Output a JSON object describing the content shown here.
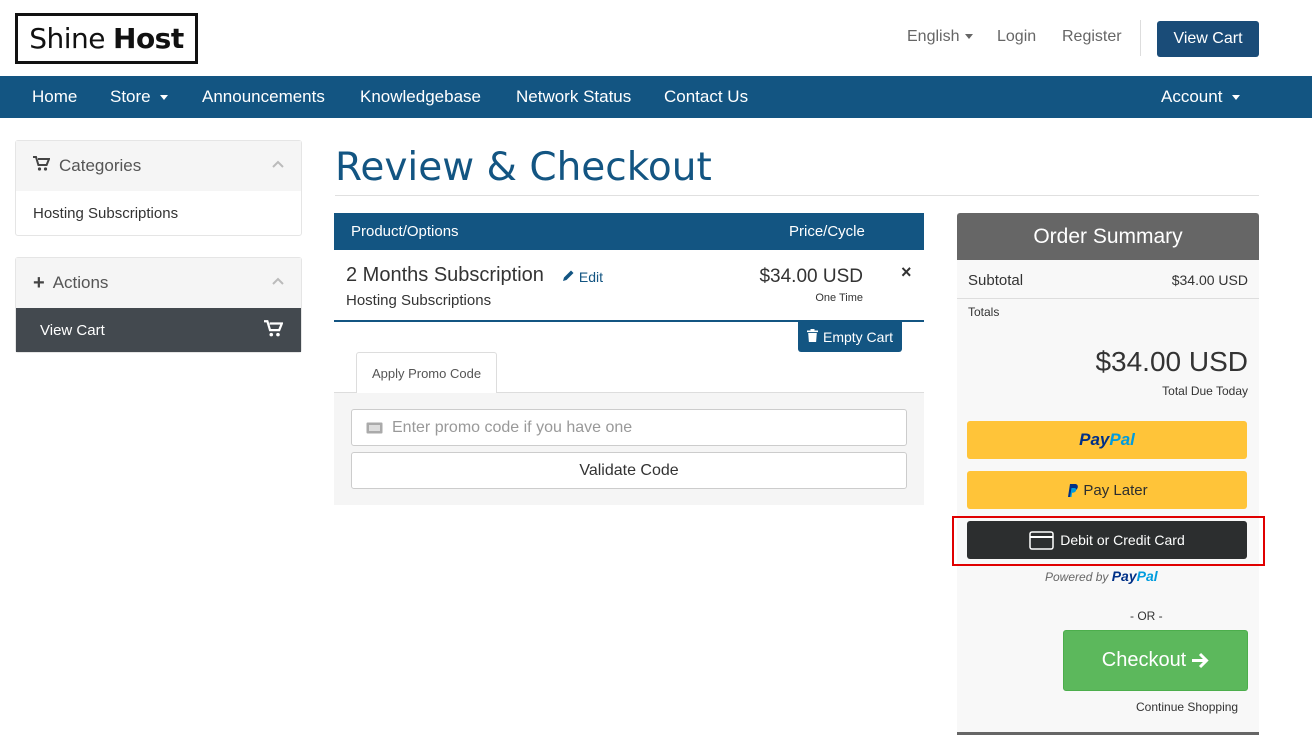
{
  "brand": {
    "logo_left": "Shine",
    "logo_right": "Host"
  },
  "header": {
    "language": "English",
    "login": "Login",
    "register": "Register",
    "view_cart": "View Cart"
  },
  "nav": {
    "items": [
      "Home",
      "Store",
      "Announcements",
      "Knowledgebase",
      "Network Status",
      "Contact Us"
    ],
    "account": "Account"
  },
  "sidebar": {
    "categories": {
      "title": "Categories",
      "items": [
        "Hosting Subscriptions"
      ]
    },
    "actions": {
      "title": "Actions",
      "items": [
        "View Cart"
      ]
    }
  },
  "page": {
    "title": "Review & Checkout"
  },
  "cart": {
    "headers": {
      "product": "Product/Options",
      "price": "Price/Cycle"
    },
    "items": [
      {
        "name": "2 Months Subscription",
        "edit": "Edit",
        "group": "Hosting Subscriptions",
        "price": "$34.00 USD",
        "cycle": "One Time",
        "remove": "×"
      }
    ],
    "empty_cart": "Empty Cart"
  },
  "promo": {
    "tab": "Apply Promo Code",
    "placeholder": "Enter promo code if you have one",
    "validate": "Validate Code"
  },
  "summary": {
    "title": "Order Summary",
    "subtotal_label": "Subtotal",
    "subtotal_value": "$34.00 USD",
    "totals_label": "Totals",
    "total_value": "$34.00 USD",
    "total_caption": "Total Due Today",
    "paypal_brand_a": "Pay",
    "paypal_brand_b": "Pal",
    "paylater": "Pay Later",
    "card": "Debit or Credit Card",
    "powered_by": "Powered by",
    "or": "- OR -",
    "checkout": "Checkout",
    "continue": "Continue Shopping"
  },
  "colors": {
    "primary": "#135582",
    "paypal_yellow": "#ffc439",
    "paypal_dark": "#003087",
    "paypal_light": "#009cde",
    "checkout_green": "#5cb85c",
    "highlight": "#e00000"
  }
}
